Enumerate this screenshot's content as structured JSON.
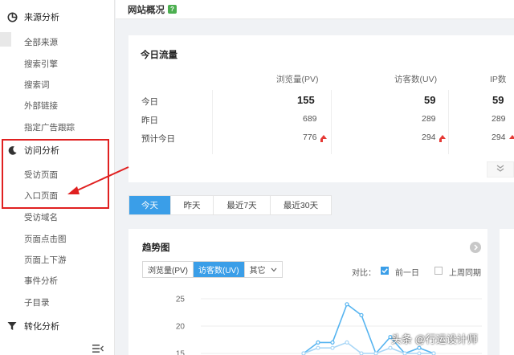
{
  "sidebar": {
    "section_source": {
      "label": "来源分析",
      "icon": "pie-chart-icon",
      "items": [
        "全部来源",
        "搜索引擎",
        "搜索词",
        "外部链接",
        "指定广告跟踪"
      ]
    },
    "section_visit": {
      "label": "访问分析",
      "icon": "half-moon-icon",
      "items": [
        "受访页面",
        "入口页面",
        "受访域名",
        "页面点击图",
        "页面上下游",
        "事件分析",
        "子目录"
      ]
    },
    "section_convert": {
      "label": "转化分析",
      "icon": "funnel-icon"
    }
  },
  "header": {
    "title": "网站概况",
    "help_label": "?"
  },
  "today": {
    "title": "今日流量",
    "columns": [
      "浏览量(PV)",
      "访客数(UV)",
      "IP数"
    ],
    "rows": [
      {
        "label": "今日",
        "values": [
          "155",
          "59",
          "59"
        ]
      },
      {
        "label": "昨日",
        "values": [
          "689",
          "289",
          "289"
        ]
      },
      {
        "label": "预计今日",
        "values": [
          "776",
          "294",
          "294"
        ]
      }
    ]
  },
  "tabs": [
    "今天",
    "昨天",
    "最近7天",
    "最近30天"
  ],
  "trend": {
    "title": "趋势图",
    "metrics": [
      "浏览量(PV)",
      "访客数(UV)",
      "其它"
    ],
    "active_metric": "访客数(UV)",
    "compare_label": "对比：",
    "compare_options": [
      {
        "label": "前一日",
        "checked": true
      },
      {
        "label": "上周同期",
        "checked": false
      }
    ]
  },
  "chart_data": {
    "type": "line",
    "y_ticks": [
      "25",
      "20",
      "15"
    ],
    "series": [
      {
        "values": [
          15,
          17,
          17,
          24,
          22,
          15,
          18,
          15,
          16,
          15
        ]
      },
      {
        "values": [
          15,
          16,
          16,
          17,
          15,
          15,
          16,
          15,
          15,
          15
        ]
      }
    ]
  },
  "colors": {
    "accent": "#3a9ee8",
    "annotation": "#e02020",
    "up": "#e53935"
  },
  "watermark": "头条 @行运设计师"
}
